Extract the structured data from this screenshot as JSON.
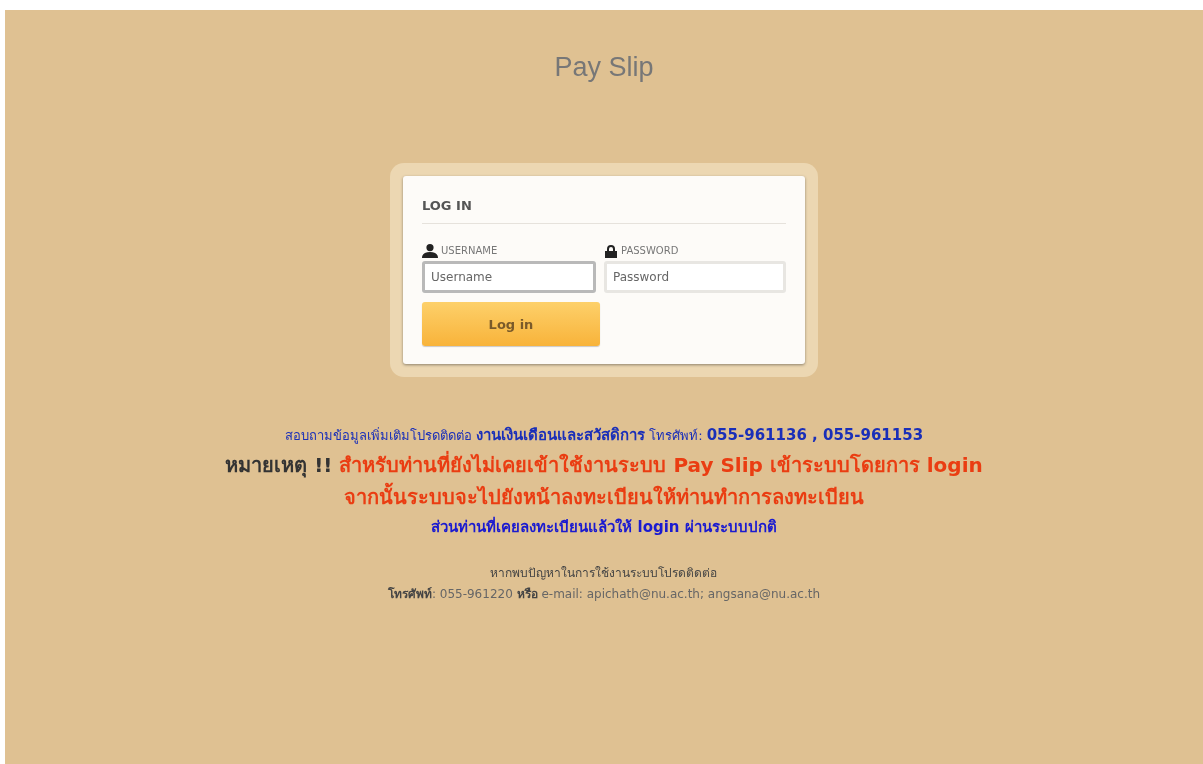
{
  "title": "Pay Slip",
  "login": {
    "heading": "LOG IN",
    "username_label": "USERNAME",
    "username_placeholder": "Username",
    "password_label": "PASSWORD",
    "password_placeholder": "Password",
    "button": "Log in"
  },
  "contact": "สอบถามข้อมูลเพิ่มเติมโปรดติดต่อ **งานเงินเดือนและสวัสดิการ** โทรศัพท์: **055-961136 , 055-961153**",
  "note": {
    "label": "หมายเหตุ !!",
    "text": "สำหรับท่านที่ยังไม่เคยเข้าใช้งานระบบ Pay Slip เข้าระบบโดยการ login"
  },
  "note_continued": "จากนั้นระบบจะไปยังหน้าลงทะเบียนให้ท่านทำการลงทะเบียน",
  "note_registered": "ส่วนท่านที่เคยลงทะเบียนแล้วให้ login ผ่านระบบปกติ",
  "help": "หากพบปัญหาในการใช้งานระบบโปรดติดต่อ",
  "help_contact": "**โทรศัพท์**: 055-961220 **หรือ** e-mail: apichath@nu.ac.th; angsana@nu.ac.th"
}
